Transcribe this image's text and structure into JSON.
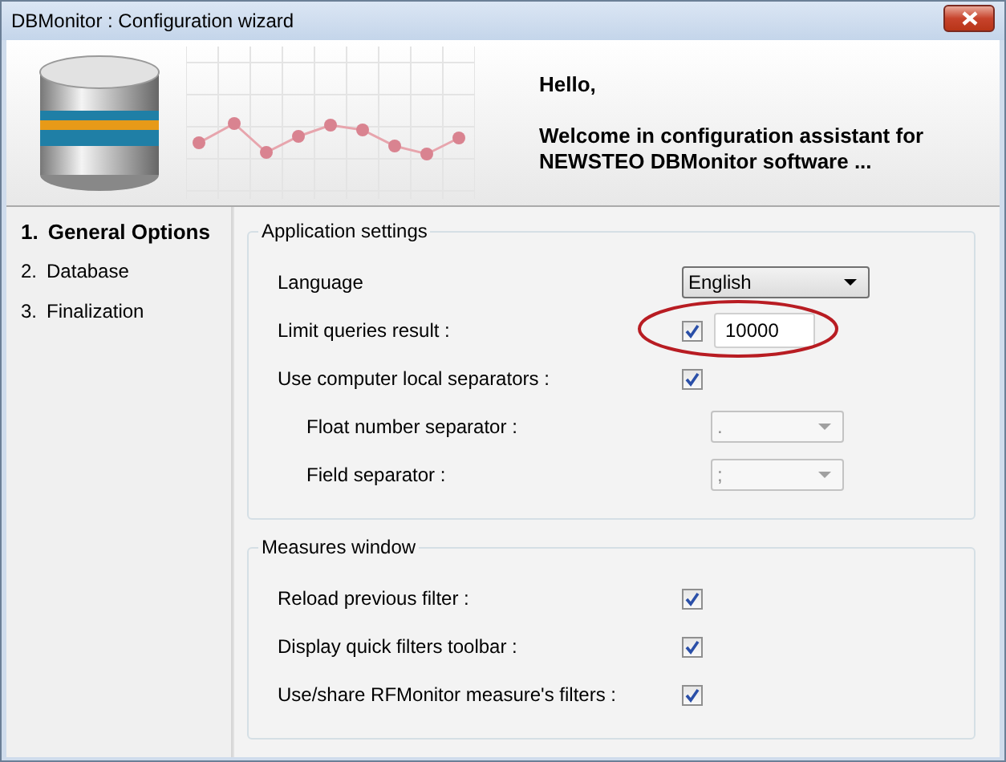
{
  "window": {
    "title": "DBMonitor : Configuration wizard"
  },
  "header": {
    "greeting": "Hello,",
    "message": "Welcome in configuration assistant for NEWSTEO DBMonitor software ..."
  },
  "steps": [
    {
      "number": "1.",
      "label": "General Options",
      "selected": true
    },
    {
      "number": "2.",
      "label": "Database",
      "selected": false
    },
    {
      "number": "3.",
      "label": "Finalization",
      "selected": false
    }
  ],
  "groups": [
    {
      "title": "Application settings",
      "rows": [
        {
          "kind": "dropdown",
          "label": "Language",
          "value": "English",
          "disabled": false
        },
        {
          "kind": "checkbox-input",
          "label": "Limit queries result :",
          "checked": true,
          "value": "10000",
          "highlighted": true
        },
        {
          "kind": "checkbox",
          "label": "Use computer local separators :",
          "checked": true,
          "children": [
            {
              "kind": "dropdown",
              "label": "Float number separator :",
              "value": ".",
              "disabled": true
            },
            {
              "kind": "dropdown",
              "label": "Field separator :",
              "value": ";",
              "disabled": true
            }
          ]
        }
      ]
    },
    {
      "title": "Measures window",
      "rows": [
        {
          "kind": "checkbox",
          "label": "Reload previous filter :",
          "checked": true
        },
        {
          "kind": "checkbox",
          "label": "Display quick filters toolbar :",
          "checked": true
        },
        {
          "kind": "checkbox",
          "label": "Use/share RFMonitor measure's filters :",
          "checked": true
        }
      ]
    }
  ]
}
